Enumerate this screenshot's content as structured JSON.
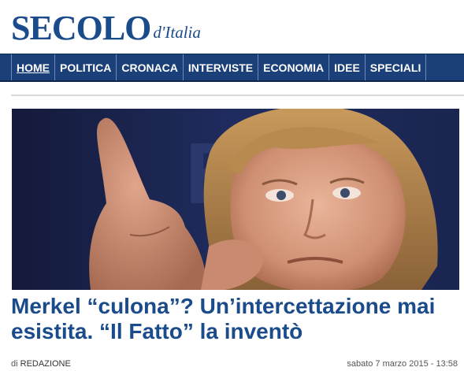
{
  "logo": {
    "main": "SECOLO",
    "sub": "d'Italia"
  },
  "nav": {
    "items": [
      "HOME",
      "POLITICA",
      "CRONACA",
      "INTERVISTE",
      "ECONOMIA",
      "IDEE",
      "SPECIALI"
    ]
  },
  "article": {
    "headline": "Merkel “culona”? Un’intercettazione mai esistita. “Il Fatto” la inventò",
    "byline_prefix": "di",
    "author": "REDAZIONE",
    "date": "sabato 7 marzo 2015 - 13:58"
  },
  "colors": {
    "brand": "#1a4b8a",
    "nav_bg": "#1b3f78"
  }
}
